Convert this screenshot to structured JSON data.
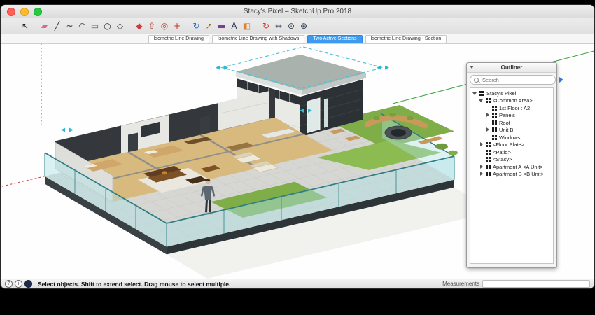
{
  "window": {
    "title": "Stacy's Pixel – SketchUp Pro 2018"
  },
  "toolbar": {
    "tools": [
      {
        "name": "select-tool",
        "label": "Select",
        "glyph": "↖",
        "color": "#1a1a1a",
        "gap": false
      },
      {
        "name": "eraser-tool",
        "label": "Eraser",
        "glyph": "▰",
        "color": "#d96a8f",
        "gap": true
      },
      {
        "name": "line-tool",
        "label": "Line",
        "glyph": "╱",
        "color": "#333333",
        "gap": false
      },
      {
        "name": "freehand-tool",
        "label": "Freehand",
        "glyph": "~",
        "color": "#333333",
        "gap": false
      },
      {
        "name": "arc-tool",
        "label": "Arc",
        "glyph": "◠",
        "color": "#333333",
        "gap": false
      },
      {
        "name": "rectangle-tool",
        "label": "Rectangle",
        "glyph": "▭",
        "color": "#a0522d",
        "gap": false
      },
      {
        "name": "circle-tool",
        "label": "Circle",
        "glyph": "○",
        "color": "#333333",
        "gap": false
      },
      {
        "name": "polygon-tool",
        "label": "Polygon",
        "glyph": "◇",
        "color": "#333333",
        "gap": false
      },
      {
        "name": "paint-bucket-tool",
        "label": "Paint Bucket",
        "glyph": "◆",
        "color": "#cc3b3b",
        "gap": true
      },
      {
        "name": "push-pull-tool",
        "label": "Push/Pull",
        "glyph": "⇧",
        "color": "#b5432e",
        "gap": false
      },
      {
        "name": "offset-tool",
        "label": "Offset",
        "glyph": "◎",
        "color": "#b5432e",
        "gap": false
      },
      {
        "name": "move-tool",
        "label": "Move",
        "glyph": "+",
        "color": "#c0392b",
        "gap": false
      },
      {
        "name": "rotate-tool",
        "label": "Rotate",
        "glyph": "↻",
        "color": "#2e6fbd",
        "gap": true
      },
      {
        "name": "scale-tool",
        "label": "Scale",
        "glyph": "↗",
        "color": "#8a6d3b",
        "gap": false
      },
      {
        "name": "tape-measure-tool",
        "label": "Tape Measure",
        "glyph": "▬",
        "color": "#7d3c98",
        "gap": false
      },
      {
        "name": "text-tool",
        "label": "Text",
        "glyph": "A",
        "color": "#2c3e50",
        "gap": false
      },
      {
        "name": "section-plane-tool",
        "label": "Section Plane",
        "glyph": "◧",
        "color": "#e67e22",
        "gap": false
      },
      {
        "name": "orbit-tool",
        "label": "Orbit",
        "glyph": "↻",
        "color": "#c0392b",
        "gap": true
      },
      {
        "name": "pan-tool",
        "label": "Pan",
        "glyph": "↔",
        "color": "#34495e",
        "gap": false
      },
      {
        "name": "zoom-tool",
        "label": "Zoom",
        "glyph": "⊙",
        "color": "#2c3e50",
        "gap": false
      },
      {
        "name": "zoom-extents-tool",
        "label": "Zoom Extents",
        "glyph": "⊕",
        "color": "#2c3e50",
        "gap": false
      }
    ]
  },
  "scene_tabs": {
    "items": [
      {
        "label": "Isometric Line Drawing",
        "active": false
      },
      {
        "label": "Isometric Line Drawing with Shadows",
        "active": false
      },
      {
        "label": "Two Active Sections",
        "active": true
      },
      {
        "label": "Isometric Line Drawing - Section",
        "active": false
      }
    ]
  },
  "outliner": {
    "title": "Outliner",
    "search_placeholder": "Search",
    "tree": [
      {
        "label": "Stacy's Pixel",
        "level": 0,
        "disclosure": "expanded"
      },
      {
        "label": "<Common Area>",
        "level": 1,
        "disclosure": "expanded"
      },
      {
        "label": "1st Floor : A2",
        "level": 2,
        "disclosure": "none"
      },
      {
        "label": "Panels",
        "level": 2,
        "disclosure": "collapsed"
      },
      {
        "label": "Roof",
        "level": 2,
        "disclosure": "none"
      },
      {
        "label": "Unit B",
        "level": 2,
        "disclosure": "collapsed"
      },
      {
        "label": "Windows",
        "level": 2,
        "disclosure": "none"
      },
      {
        "label": "<Floor Plate>",
        "level": 1,
        "disclosure": "collapsed"
      },
      {
        "label": "<Patio>",
        "level": 1,
        "disclosure": "none"
      },
      {
        "label": "<Stacy>",
        "level": 1,
        "disclosure": "none"
      },
      {
        "label": "Apartment A <A Unit>",
        "level": 1,
        "disclosure": "collapsed"
      },
      {
        "label": "Apartment B <B Unit>",
        "level": 1,
        "disclosure": "collapsed"
      }
    ]
  },
  "statusbar": {
    "icons": [
      {
        "name": "help-icon",
        "type": "circle",
        "glyph": "?"
      },
      {
        "name": "info-icon",
        "type": "circle",
        "glyph": "i"
      },
      {
        "name": "geolocation-icon",
        "type": "dot",
        "glyph": ""
      }
    ],
    "message": "Select objects. Shift to extend select. Drag mouse to select multiple.",
    "measurements_label": "Measurements",
    "measurements_value": ""
  },
  "colors": {
    "accent_blue": "#3e9af0",
    "glass": "#a8e0e4",
    "glass_frame": "#2f7e84",
    "grass_light": "#8cbb52",
    "grass_dark": "#7fae49",
    "wood_floor": "#d8b97e",
    "charcoal_wall": "#2c3136",
    "paver": "#d6d6d3",
    "section_cyan": "#2fb9cf"
  }
}
